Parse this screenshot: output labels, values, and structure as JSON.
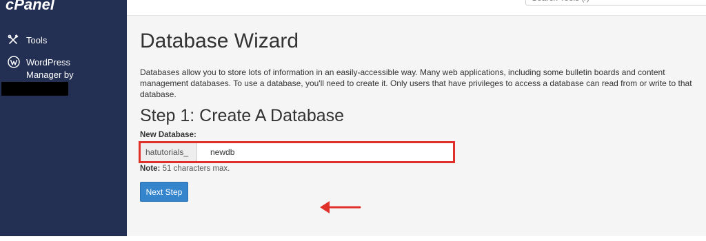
{
  "sidebar": {
    "logo": "cPanel",
    "items": [
      {
        "label": "Tools",
        "icon": "tools-icon"
      },
      {
        "label_line1": "WordPress",
        "label_line2": "Manager by",
        "icon": "wordpress-icon"
      }
    ]
  },
  "search": {
    "placeholder": "Search Tools (/)"
  },
  "main": {
    "title": "Database Wizard",
    "intro": "Databases allow you to store lots of information in an easily-accessible way. Many web applications, including some bulletin boards and content management databases. To use a database, you'll need to create it. Only users that have privileges to access a database can read from or write to that database.",
    "step_title": "Step 1: Create A Database",
    "field_label": "New Database:",
    "prefix": "hatutorials_",
    "value": "newdb",
    "note_label": "Note:",
    "note_text": " 51 characters max.",
    "next_label": "Next Step"
  },
  "colors": {
    "sidebar_bg": "#233053",
    "highlight_red": "#e0302a",
    "button_blue": "#3585cc"
  }
}
